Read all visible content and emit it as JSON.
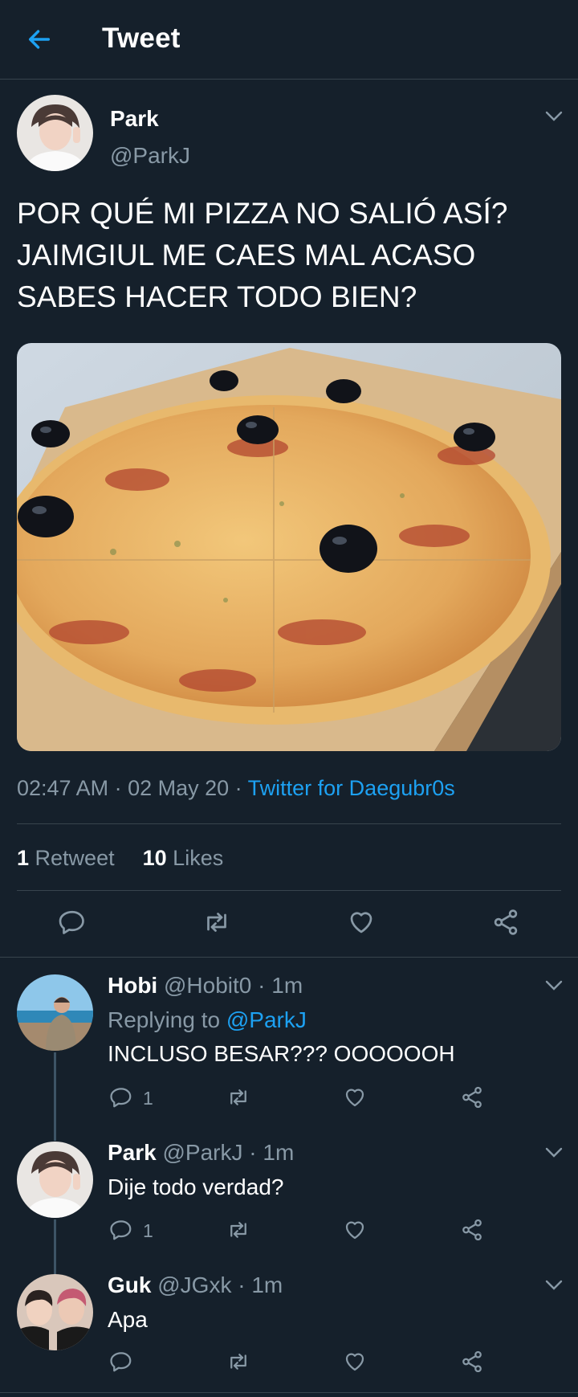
{
  "header": {
    "title": "Tweet"
  },
  "tweet": {
    "name": "Park",
    "handle": "@ParkJ",
    "text_lines": [
      "POR QUÉ MI PIZZA NO SALIÓ ASÍ?",
      "JAIMGIUL ME CAES MAL ACASO",
      "SABES HACER TODO BIEN?"
    ],
    "time": "02:47 AM · 02 May 20 · ",
    "source": "Twitter for Daegubr0s",
    "retweets_count": "1",
    "retweets_label": " Retweet",
    "likes_count": "10",
    "likes_label": " Likes"
  },
  "replies": [
    {
      "name": "Hobi",
      "handle": "@Hobit0 · 1m",
      "replying_prefix": "Replying to ",
      "replying_to": "@ParkJ",
      "text": "INCLUSO BESAR??? OOOOOOH",
      "reply_count": "1"
    },
    {
      "name": "Park",
      "handle": "@ParkJ · 1m",
      "text": "Dije todo verdad?",
      "reply_count": "1"
    },
    {
      "name": "Guk",
      "handle": "@JGxk · 1m",
      "text": "Apa",
      "reply_count": ""
    }
  ],
  "colors": {
    "background": "#15202b",
    "accent": "#1da1f2",
    "muted": "#8899a6",
    "divider": "#38444d"
  }
}
